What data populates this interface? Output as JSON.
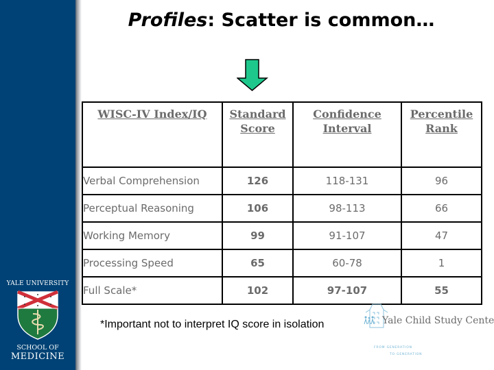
{
  "slide": {
    "title_italic": "Profiles",
    "title_rest": ": Scatter is common…",
    "arrow_color": "#1ec88c",
    "sidebar_color": "#004275"
  },
  "table": {
    "headers": [
      "WISC-IV Index/IQ",
      "Standard Score",
      "Confidence Interval",
      "Percentile Rank"
    ],
    "rows": [
      {
        "name": "Verbal Comprehension",
        "score": "126",
        "ci": "118-131",
        "pct": "96"
      },
      {
        "name": "Perceptual Reasoning",
        "score": "106",
        "ci": "98-113",
        "pct": "66"
      },
      {
        "name": "Working Memory",
        "score": "99",
        "ci": "91-107",
        "pct": "47"
      },
      {
        "name": "Processing Speed",
        "score": "65",
        "ci": "60-78",
        "pct": "1"
      },
      {
        "name": "Full Scale*",
        "score": "102",
        "ci": "97-107",
        "pct": "55"
      }
    ]
  },
  "footnote": "*Important not to interpret IQ score in isolation",
  "logos": {
    "yale": {
      "top": "YALE UNIVERSITY",
      "school": "SCHOOL OF",
      "name": "MEDICINE"
    },
    "child_study": {
      "name": "Yale Child Study Center",
      "tagline1": "FROM GENERATION",
      "tagline2": "TO GENERATION"
    }
  }
}
